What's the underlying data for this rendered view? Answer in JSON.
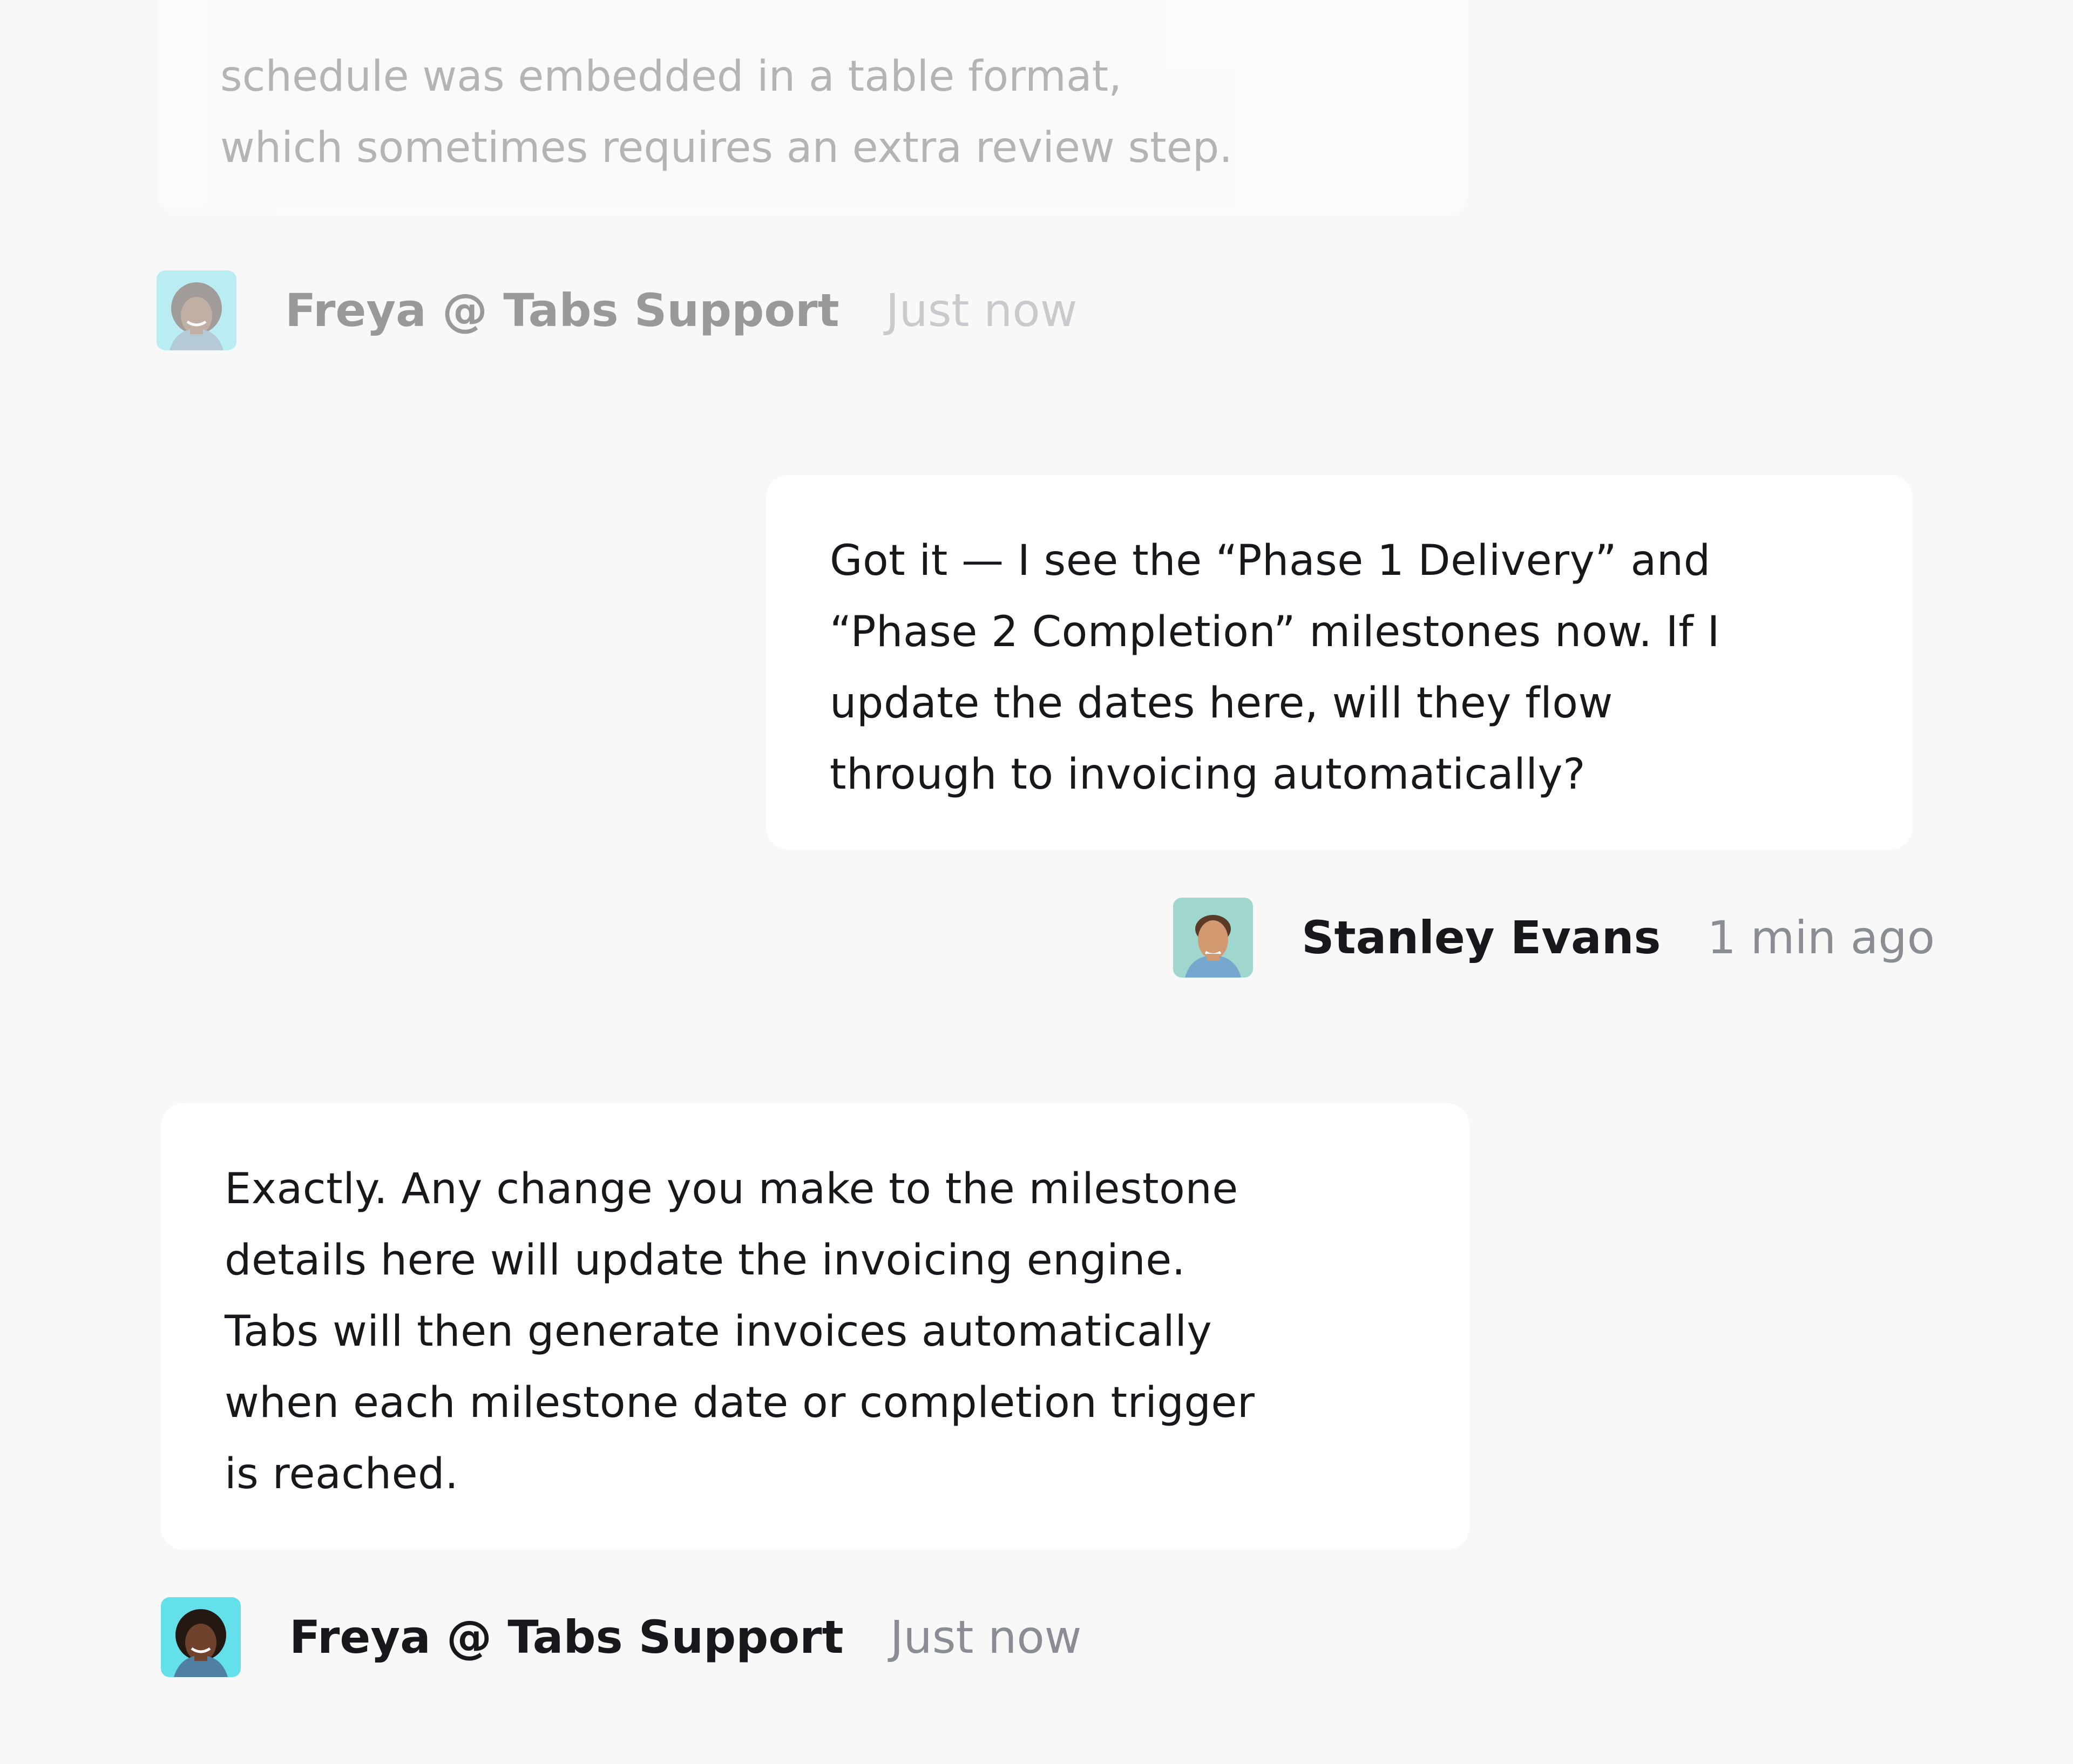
{
  "messages": [
    {
      "text": "schedule was embedded in a table format,\nwhich sometimes requires an extra review step."
    },
    {
      "sender": "Freya @ Tabs Support",
      "time": "Just now",
      "avatar": "agent-avatar"
    },
    {
      "text": "Got it — I see the “Phase 1 Delivery” and\n“Phase 2 Completion” milestones now. If I\nupdate the dates here, will they flow\nthrough to invoicing automatically?",
      "sender": "Stanley Evans",
      "time": "1 min ago",
      "avatar": "user-avatar"
    },
    {
      "text": "Exactly. Any change you make to the milestone\ndetails here will update the invoicing engine.\nTabs will then generate invoices automatically\nwhen each milestone date or completion trigger\nis reached.",
      "sender": "Freya @ Tabs Support",
      "time": "Just now",
      "avatar": "agent-avatar"
    }
  ],
  "colors": {
    "background": "#f8f8f8",
    "bubble": "#ffffff",
    "text": "#17181c",
    "muted": "#8a8d93",
    "agent_avatar_bg": "#63e0ea",
    "user_avatar_bg": "#9fd7cf"
  }
}
